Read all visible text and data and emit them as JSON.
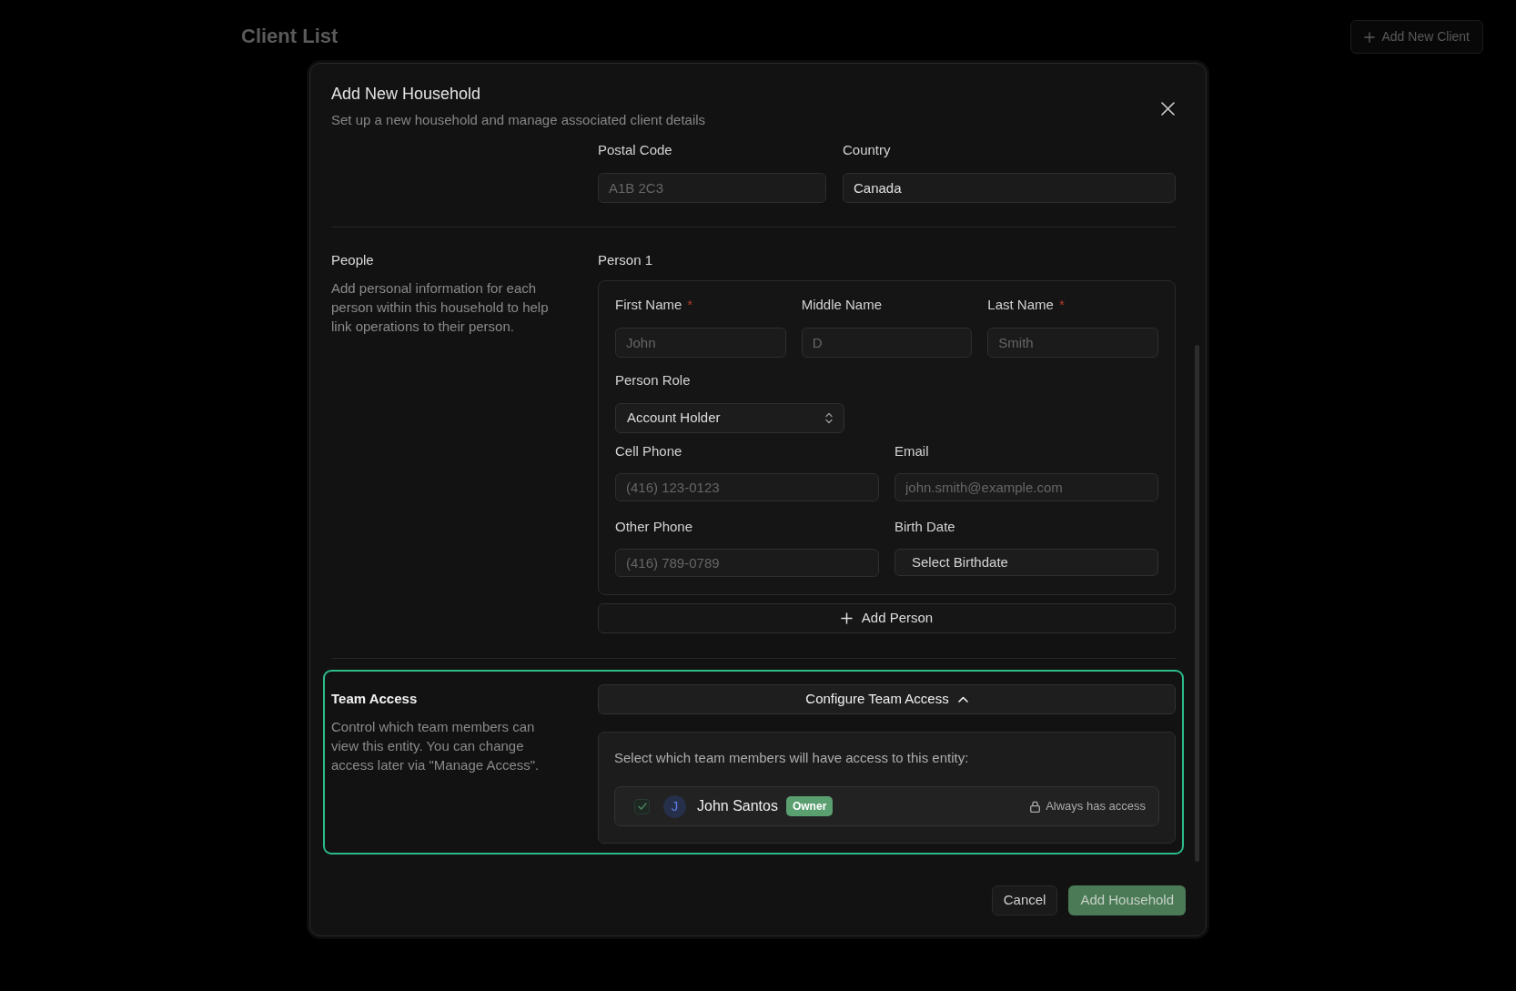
{
  "page": {
    "title": "Client List",
    "action": "Add New Client"
  },
  "dialog": {
    "title": "Add New Household",
    "subtitle": "Set up a new household and manage associated client details",
    "address_fields": [
      {
        "kind": "text",
        "label": "Postal Code",
        "placeholder": "A1B 2C3"
      },
      {
        "kind": "text",
        "label": "Country",
        "value": "Canada"
      }
    ],
    "people": {
      "title": "People",
      "description": "Add personal information for each person within this household to help link operations to their person.",
      "persons": [
        {
          "heading": "Person 1",
          "field_rows": [
            [
              {
                "kind": "text",
                "label": "First Name",
                "required_mark": "*",
                "placeholder": "John"
              },
              {
                "kind": "text",
                "label": "Middle Name",
                "placeholder": "D"
              },
              {
                "kind": "text",
                "label": "Last Name",
                "required_mark": "*",
                "placeholder": "Smith"
              }
            ],
            [
              {
                "kind": "select",
                "label": "Person Role",
                "value": "Account Holder"
              }
            ],
            [
              {
                "kind": "text",
                "label": "Cell Phone",
                "placeholder": "(416) 123-0123"
              },
              {
                "kind": "text",
                "label": "Email",
                "placeholder": "john.smith@example.com"
              }
            ],
            [
              {
                "kind": "text",
                "label": "Other Phone",
                "placeholder": "(416) 789-0789"
              },
              {
                "kind": "date",
                "label": "Birth Date",
                "value": "Select Birthdate"
              }
            ]
          ]
        }
      ],
      "add_button": "Add Person"
    },
    "team_access": {
      "title": "Team Access",
      "description": "Control which team members can view this entity. You can change access later via \"Manage Access\".",
      "highlighted": true,
      "toggle": {
        "label": "Configure Team Access",
        "expanded": true
      },
      "prompt": "Select which team members will have access to this entity:",
      "members": [
        {
          "initial": "J",
          "name": "John Santos",
          "badge": "Owner",
          "checked": true,
          "disabled": true,
          "access_note": "Always has access"
        }
      ]
    },
    "buttons": [
      {
        "kind": "secondary",
        "label": "Cancel",
        "disabled": false
      },
      {
        "kind": "primary",
        "label": "Add Household",
        "disabled": true
      }
    ]
  }
}
